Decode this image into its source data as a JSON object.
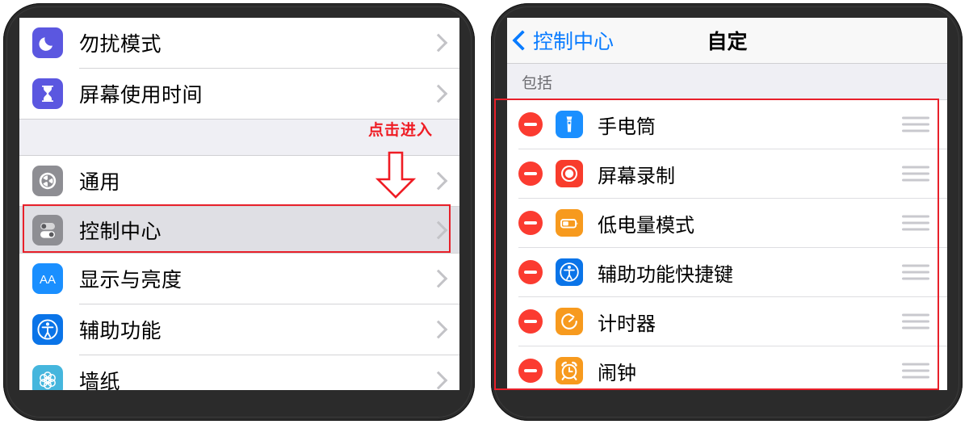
{
  "left_phone": {
    "settings_rows_group1": [
      {
        "label": "勿扰模式",
        "icon": "moon-icon",
        "icon_bg": "#5b57e0"
      },
      {
        "label": "屏幕使用时间",
        "icon": "hourglass-icon",
        "icon_bg": "#5b57e0"
      }
    ],
    "settings_rows_group2": [
      {
        "label": "通用",
        "icon": "gear-icon",
        "icon_bg": "#8e8e93"
      },
      {
        "label": "控制中心",
        "icon": "control-center-toggles-icon",
        "icon_bg": "#8e8e93",
        "selected": true
      },
      {
        "label": "显示与亮度",
        "icon": "aa-text-icon",
        "icon_bg": "#1a8fff"
      },
      {
        "label": "辅助功能",
        "icon": "accessibility-icon",
        "icon_bg": "#0a74e8"
      },
      {
        "label": "墙纸",
        "icon": "wallpaper-flower-icon",
        "icon_bg": "#45b6dd"
      }
    ],
    "annotation": {
      "text": "点击进入",
      "color": "#ef1c24",
      "arrow": "down-arrow-outline"
    }
  },
  "right_phone": {
    "nav": {
      "back_label": "控制中心",
      "back_icon": "chevron-left-icon",
      "title": "自定"
    },
    "section_header": "包括",
    "include_items": [
      {
        "label": "手电筒",
        "icon": "flashlight-icon",
        "icon_bg": "#1a8fff",
        "remove_icon": "minus-circle-icon",
        "drag_icon": "drag-handle-icon"
      },
      {
        "label": "屏幕录制",
        "icon": "screen-record-icon",
        "icon_bg": "#f83c2c",
        "remove_icon": "minus-circle-icon",
        "drag_icon": "drag-handle-icon"
      },
      {
        "label": "低电量模式",
        "icon": "battery-low-icon",
        "icon_bg": "#f79a1e",
        "remove_icon": "minus-circle-icon",
        "drag_icon": "drag-handle-icon"
      },
      {
        "label": "辅助功能快捷键",
        "icon": "accessibility-icon",
        "icon_bg": "#0a74e8",
        "remove_icon": "minus-circle-icon",
        "drag_icon": "drag-handle-icon"
      },
      {
        "label": "计时器",
        "icon": "timer-icon",
        "icon_bg": "#f79a1e",
        "remove_icon": "minus-circle-icon",
        "drag_icon": "drag-handle-icon"
      },
      {
        "label": "闹钟",
        "icon": "alarm-clock-icon",
        "icon_bg": "#f79a1e",
        "remove_icon": "minus-circle-icon",
        "drag_icon": "drag-handle-icon"
      }
    ],
    "highlight_color": "#e8202a"
  }
}
